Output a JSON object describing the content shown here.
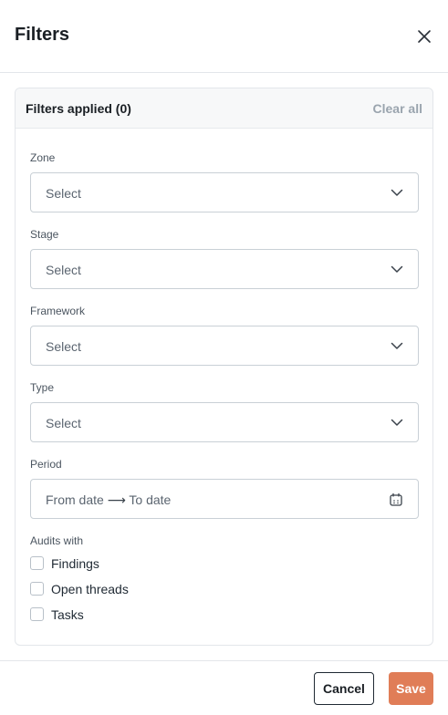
{
  "header": {
    "title": "Filters",
    "close_icon": "close-icon"
  },
  "panel": {
    "applied_label": "Filters applied (0)",
    "clear_all_label": "Clear all"
  },
  "fields": {
    "zone": {
      "label": "Zone",
      "value": "Select"
    },
    "stage": {
      "label": "Stage",
      "value": "Select"
    },
    "framework": {
      "label": "Framework",
      "value": "Select"
    },
    "type": {
      "label": "Type",
      "value": "Select"
    },
    "period": {
      "label": "Period",
      "from": "From date",
      "arrow": "⟶",
      "to": "To date"
    }
  },
  "audits_with": {
    "label": "Audits with",
    "options": [
      {
        "label": "Findings",
        "checked": false
      },
      {
        "label": "Open threads",
        "checked": false
      },
      {
        "label": "Tasks",
        "checked": false
      }
    ]
  },
  "footer": {
    "cancel_label": "Cancel",
    "save_label": "Save"
  },
  "colors": {
    "accent": "#e07d57",
    "border": "#c9d0d6",
    "muted_text": "#9aa4ae"
  }
}
